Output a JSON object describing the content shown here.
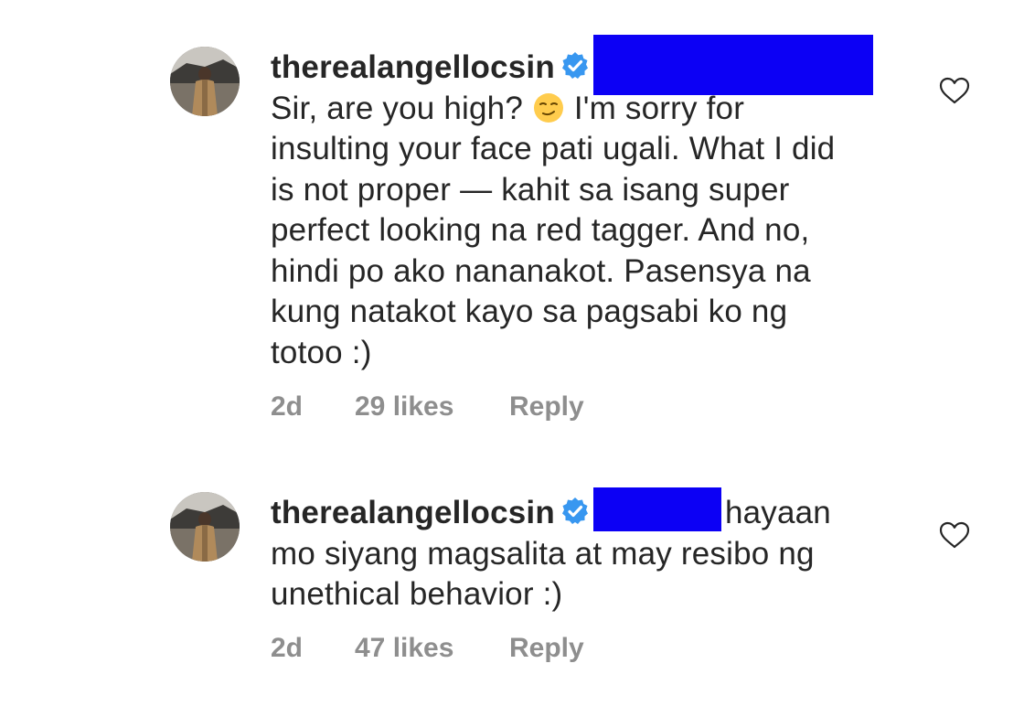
{
  "comments": [
    {
      "username": "therealangellocsin",
      "lines": [
        "",
        "Sir, are you high? ",
        " I'm sorry for",
        "insulting your face pati ugali. What I did",
        "is not proper — kahit sa isang super",
        "perfect looking na red tagger. And no,",
        "hindi po ako nananakot. Pasensya na",
        "kung natakot kayo sa pagsabi ko ng",
        "totoo :)"
      ],
      "time": "2d",
      "likes": "29 likes",
      "reply": "Reply"
    },
    {
      "username": "therealangellocsin",
      "first_line_tail": "hayaan",
      "lines": [
        "mo siyang magsalita at may resibo ng",
        "unethical behavior :)"
      ],
      "time": "2d",
      "likes": "47 likes",
      "reply": "Reply"
    }
  ],
  "icons": {
    "verified": "verified-badge-icon",
    "heart": "heart-outline-icon",
    "emoji": "smirking-face-emoji"
  },
  "colors": {
    "text": "#262626",
    "meta": "#8e8e8e",
    "verified": "#3897f0",
    "redaction": "#0c00f5"
  }
}
